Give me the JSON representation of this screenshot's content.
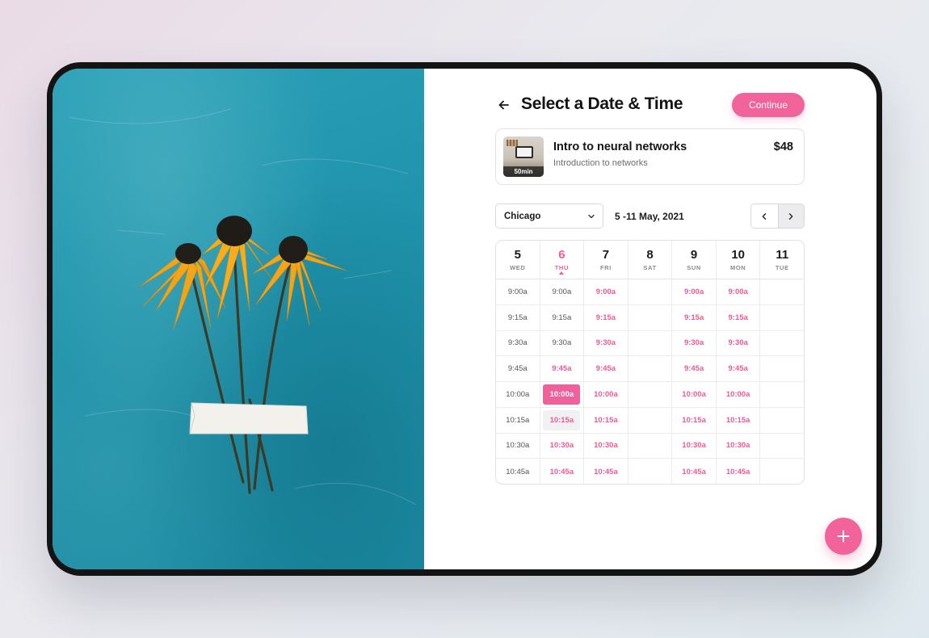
{
  "header": {
    "title": "Select a Date & Time",
    "continue_label": "Continue"
  },
  "course": {
    "title": "Intro to neural networks",
    "subtitle": "Introduction to networks",
    "price": "$48",
    "duration": "50min"
  },
  "controls": {
    "city": "Chicago",
    "date_range": "5 -11 May, 2021"
  },
  "days": [
    {
      "num": "5",
      "name": "WED"
    },
    {
      "num": "6",
      "name": "THU"
    },
    {
      "num": "7",
      "name": "FRI"
    },
    {
      "num": "8",
      "name": "SAT"
    },
    {
      "num": "9",
      "name": "SUN"
    },
    {
      "num": "10",
      "name": "MON"
    },
    {
      "num": "11",
      "name": "TUE"
    }
  ],
  "active_day_index": 1,
  "slots": [
    [
      {
        "label": "9:00a",
        "state": "booked"
      },
      {
        "label": "9:15a",
        "state": "booked"
      },
      {
        "label": "9:30a",
        "state": "booked"
      },
      {
        "label": "9:45a",
        "state": "booked"
      },
      {
        "label": "10:00a",
        "state": "booked"
      },
      {
        "label": "10:15a",
        "state": "booked"
      },
      {
        "label": "10:30a",
        "state": "booked"
      },
      {
        "label": "10:45a",
        "state": "booked"
      }
    ],
    [
      {
        "label": "9:00a",
        "state": "booked"
      },
      {
        "label": "9:15a",
        "state": "booked"
      },
      {
        "label": "9:30a",
        "state": "booked"
      },
      {
        "label": "9:45a",
        "state": "available"
      },
      {
        "label": "10:00a",
        "state": "selected"
      },
      {
        "label": "10:15a",
        "state": "hover"
      },
      {
        "label": "10:30a",
        "state": "available"
      },
      {
        "label": "10:45a",
        "state": "available"
      }
    ],
    [
      {
        "label": "9:00a",
        "state": "available"
      },
      {
        "label": "9:15a",
        "state": "available"
      },
      {
        "label": "9:30a",
        "state": "available"
      },
      {
        "label": "9:45a",
        "state": "available"
      },
      {
        "label": "10:00a",
        "state": "available"
      },
      {
        "label": "10:15a",
        "state": "available"
      },
      {
        "label": "10:30a",
        "state": "available"
      },
      {
        "label": "10:45a",
        "state": "available"
      }
    ],
    [
      {
        "label": "",
        "state": "empty"
      },
      {
        "label": "",
        "state": "empty"
      },
      {
        "label": "",
        "state": "empty"
      },
      {
        "label": "",
        "state": "empty"
      },
      {
        "label": "",
        "state": "empty"
      },
      {
        "label": "",
        "state": "empty"
      },
      {
        "label": "",
        "state": "empty"
      },
      {
        "label": "",
        "state": "empty"
      }
    ],
    [
      {
        "label": "9:00a",
        "state": "available"
      },
      {
        "label": "9:15a",
        "state": "available"
      },
      {
        "label": "9:30a",
        "state": "available"
      },
      {
        "label": "9:45a",
        "state": "available"
      },
      {
        "label": "10:00a",
        "state": "available"
      },
      {
        "label": "10:15a",
        "state": "available"
      },
      {
        "label": "10:30a",
        "state": "available"
      },
      {
        "label": "10:45a",
        "state": "available"
      }
    ],
    [
      {
        "label": "9:00a",
        "state": "available"
      },
      {
        "label": "9:15a",
        "state": "available"
      },
      {
        "label": "9:30a",
        "state": "available"
      },
      {
        "label": "9:45a",
        "state": "available"
      },
      {
        "label": "10:00a",
        "state": "available"
      },
      {
        "label": "10:15a",
        "state": "available"
      },
      {
        "label": "10:30a",
        "state": "available"
      },
      {
        "label": "10:45a",
        "state": "available"
      }
    ],
    [
      {
        "label": "",
        "state": "empty"
      },
      {
        "label": "",
        "state": "empty"
      },
      {
        "label": "",
        "state": "empty"
      },
      {
        "label": "",
        "state": "empty"
      },
      {
        "label": "",
        "state": "empty"
      },
      {
        "label": "",
        "state": "empty"
      },
      {
        "label": "",
        "state": "empty"
      },
      {
        "label": "",
        "state": "empty"
      }
    ]
  ],
  "icons": {
    "back": "arrow-left-icon",
    "city_dropdown": "chevron-down-icon",
    "prev": "chevron-left-icon",
    "next": "chevron-right-icon",
    "fab": "plus-icon"
  },
  "colors": {
    "accent": "#f2639b",
    "photo_background": "#1f93ab",
    "petal": "#f3a51a"
  }
}
